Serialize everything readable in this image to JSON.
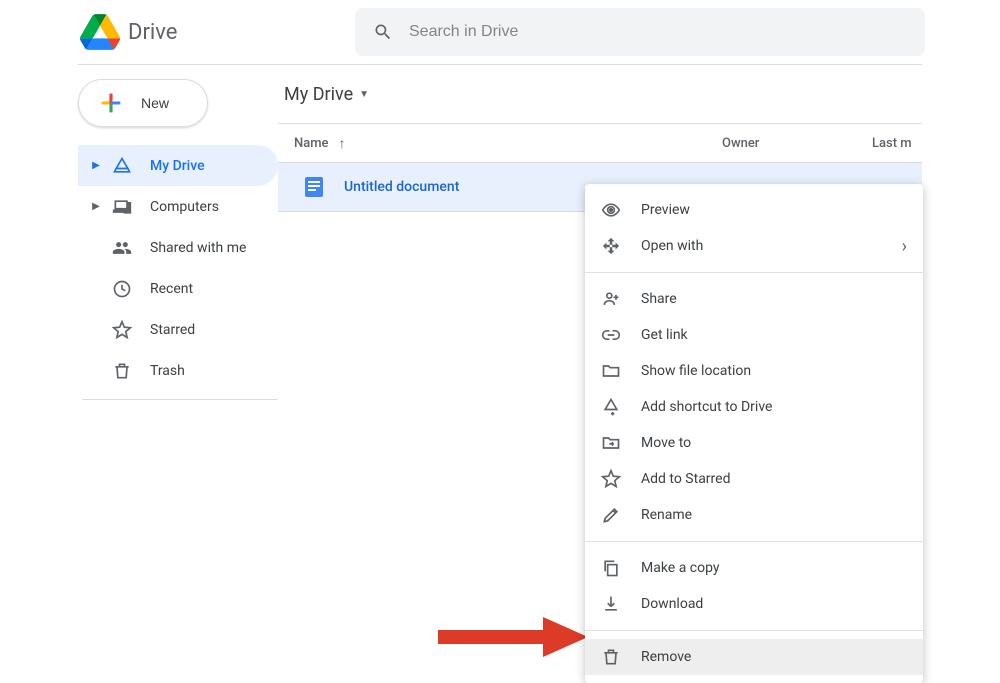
{
  "header": {
    "product_name": "Drive",
    "search_placeholder": "Search in Drive"
  },
  "sidebar": {
    "new_label": "New",
    "items": [
      {
        "label": "My Drive",
        "icon": "drive-icon",
        "expandable": true,
        "active": true
      },
      {
        "label": "Computers",
        "icon": "computers-icon",
        "expandable": true,
        "active": false
      },
      {
        "label": "Shared with me",
        "icon": "shared-icon",
        "expandable": false,
        "active": false
      },
      {
        "label": "Recent",
        "icon": "recent-icon",
        "expandable": false,
        "active": false
      },
      {
        "label": "Starred",
        "icon": "starred-icon",
        "expandable": false,
        "active": false
      },
      {
        "label": "Trash",
        "icon": "trash-icon",
        "expandable": false,
        "active": false
      }
    ]
  },
  "main": {
    "breadcrumb": "My Drive",
    "columns": {
      "name": "Name",
      "owner": "Owner",
      "modified": "Last m"
    },
    "files": [
      {
        "name": "Untitled document",
        "type": "docs"
      }
    ]
  },
  "context_menu": {
    "groups": [
      [
        {
          "label": "Preview",
          "icon": "eye-icon",
          "submenu": false
        },
        {
          "label": "Open with",
          "icon": "open-with-icon",
          "submenu": true
        }
      ],
      [
        {
          "label": "Share",
          "icon": "person-add-icon",
          "submenu": false
        },
        {
          "label": "Get link",
          "icon": "link-icon",
          "submenu": false
        },
        {
          "label": "Show file location",
          "icon": "folder-icon",
          "submenu": false
        },
        {
          "label": "Add shortcut to Drive",
          "icon": "shortcut-icon",
          "submenu": false
        },
        {
          "label": "Move to",
          "icon": "move-to-icon",
          "submenu": false
        },
        {
          "label": "Add to Starred",
          "icon": "star-icon",
          "submenu": false
        },
        {
          "label": "Rename",
          "icon": "rename-icon",
          "submenu": false
        }
      ],
      [
        {
          "label": "Make a copy",
          "icon": "copy-icon",
          "submenu": false
        },
        {
          "label": "Download",
          "icon": "download-icon",
          "submenu": false
        }
      ],
      [
        {
          "label": "Remove",
          "icon": "trash-icon",
          "submenu": false,
          "hover": true
        }
      ]
    ]
  },
  "annotation": {
    "arrow_color": "#db3b27"
  }
}
